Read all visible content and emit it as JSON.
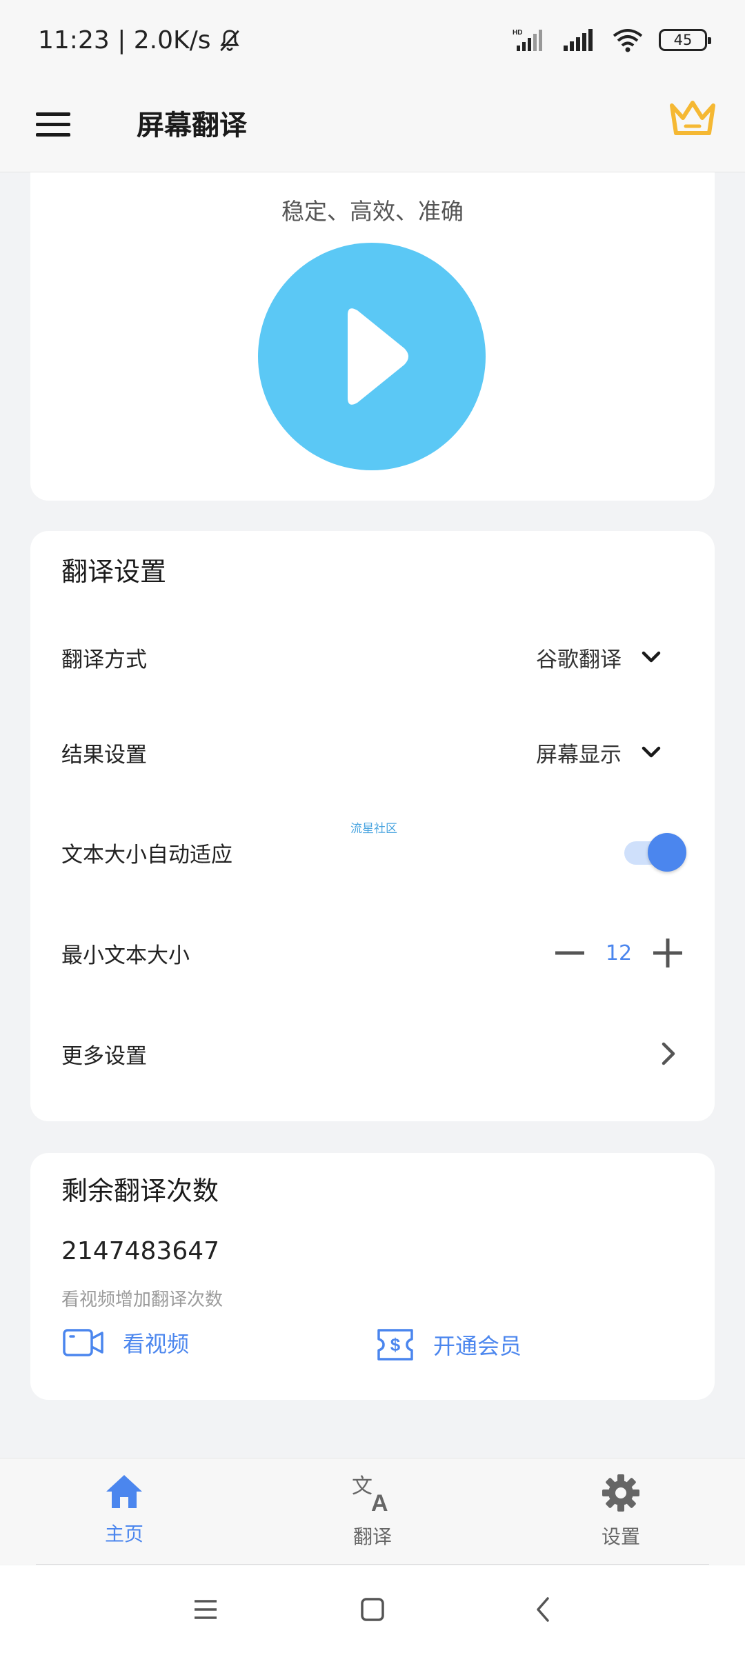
{
  "status_bar": {
    "time_speed": "11:23 | 2.0K/s",
    "battery": "45"
  },
  "app_bar": {
    "title": "屏幕翻译"
  },
  "hero": {
    "tagline": "稳定、高效、准确"
  },
  "settings": {
    "title": "翻译设置",
    "method_label": "翻译方式",
    "method_value": "谷歌翻译",
    "result_label": "结果设置",
    "result_value": "屏幕显示",
    "autosize_label": "文本大小自动适应",
    "autosize_on": true,
    "min_size_label": "最小文本大小",
    "min_size_value": "12",
    "more_label": "更多设置",
    "watermark": "流星社区"
  },
  "remaining": {
    "title": "剩余翻译次数",
    "count": "2147483647",
    "hint": "看视频增加翻译次数",
    "watch_video_label": "看视频",
    "membership_label": "开通会员"
  },
  "bottom_nav": {
    "items": [
      {
        "label": "主页",
        "icon": "home-icon",
        "active": true
      },
      {
        "label": "翻译",
        "icon": "translate-icon",
        "active": false
      },
      {
        "label": "设置",
        "icon": "gear-icon",
        "active": false
      }
    ]
  },
  "colors": {
    "accent": "#4b86ee",
    "play": "#5bc8f5",
    "crown": "#f5b833"
  }
}
